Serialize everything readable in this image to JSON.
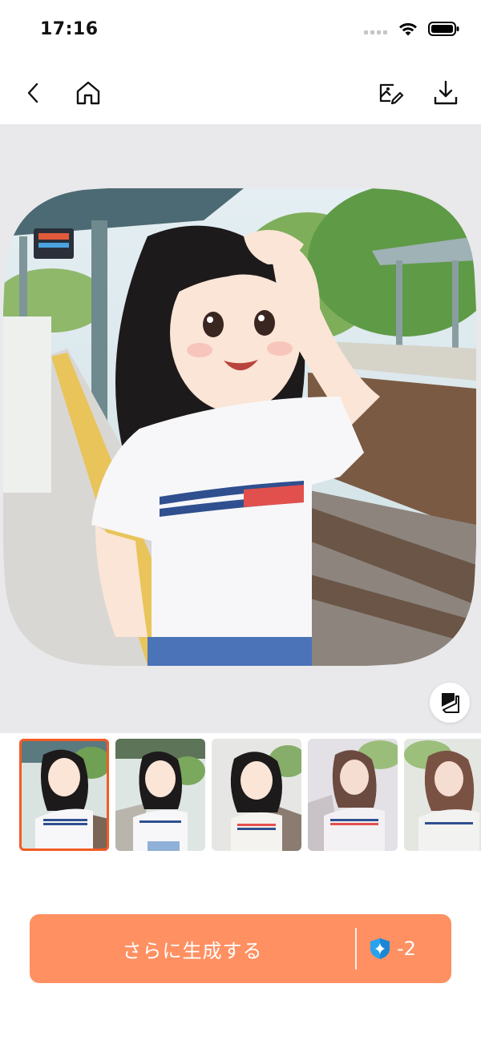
{
  "status_bar": {
    "time": "17:16"
  },
  "nav": {
    "back_icon": "chevron-left-icon",
    "home_icon": "home-icon",
    "edit_icon": "image-edit-icon",
    "download_icon": "download-icon"
  },
  "preview": {
    "compare_icon": "compare-icon"
  },
  "thumbnails": [
    {
      "selected": true
    },
    {
      "selected": false
    },
    {
      "selected": false
    },
    {
      "selected": false
    },
    {
      "selected": false
    }
  ],
  "generate": {
    "label": "さらに生成する",
    "cost": "-2",
    "cost_icon": "shield-sparkle-icon"
  },
  "colors": {
    "accent": "#fe9062",
    "selected_border": "#f35b24",
    "preview_bg": "#e9e8ea"
  }
}
